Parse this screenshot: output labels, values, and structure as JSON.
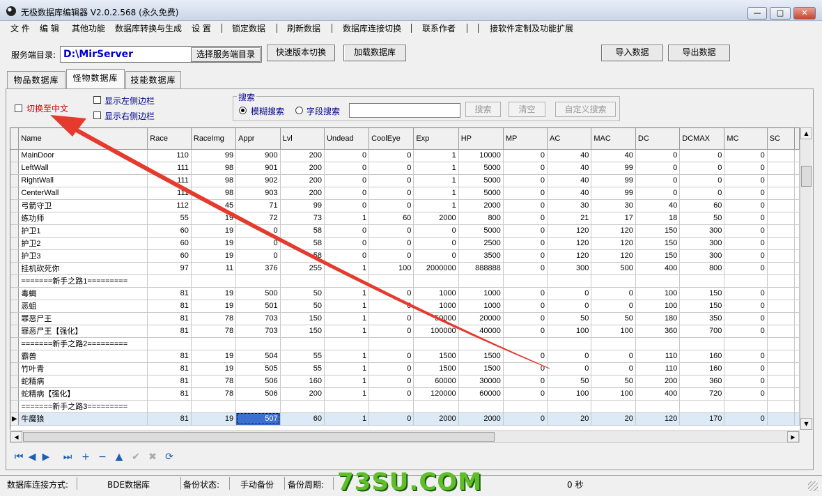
{
  "window": {
    "title": "无极数据库编辑器 V2.0.2.568 (永久免费)",
    "minimize_glyph": "—",
    "maximize_glyph": "□",
    "close_glyph": "✕"
  },
  "menu": [
    "文 件",
    "编 辑",
    "其他功能",
    "数据库转换与生成",
    "设 置",
    "锁定数据",
    "刷新数据",
    "数据库连接切换",
    "联系作者",
    "接软件定制及功能扩展"
  ],
  "toolbar": {
    "server_dir_label": "服务端目录:",
    "server_dir_value": "D:\\MirServer",
    "browse_button": "选择服务端目录",
    "quick_switch_button": "快速版本切换",
    "load_db_button": "加载数据库",
    "import_button": "导入数据",
    "export_button": "导出数据"
  },
  "tabs": [
    "物品数据库",
    "怪物数据库",
    "技能数据库"
  ],
  "active_tab": "怪物数据库",
  "options": {
    "switch_chinese": "切换至中文",
    "show_left_sidebar": "显示左侧边栏",
    "show_right_sidebar": "显示右侧边栏"
  },
  "search": {
    "legend": "搜索",
    "fuzzy_label": "模糊搜索",
    "field_label": "字段搜索",
    "query_value": "",
    "search_button": "搜索",
    "clear_button": "清空",
    "custom_button": "自定义搜索"
  },
  "grid": {
    "columns": [
      "Name",
      "Race",
      "RaceImg",
      "Appr",
      "Lvl",
      "Undead",
      "CoolEye",
      "Exp",
      "HP",
      "MP",
      "AC",
      "MAC",
      "DC",
      "DCMAX",
      "MC",
      "SC"
    ],
    "rows": [
      [
        "MainDoor",
        "110",
        "99",
        "900",
        "200",
        "0",
        "0",
        "1",
        "10000",
        "0",
        "40",
        "40",
        "0",
        "0",
        "0",
        ""
      ],
      [
        "LeftWall",
        "111",
        "98",
        "901",
        "200",
        "0",
        "0",
        "1",
        "5000",
        "0",
        "40",
        "99",
        "0",
        "0",
        "0",
        ""
      ],
      [
        "RightWall",
        "111",
        "98",
        "902",
        "200",
        "0",
        "0",
        "1",
        "5000",
        "0",
        "40",
        "99",
        "0",
        "0",
        "0",
        ""
      ],
      [
        "CenterWall",
        "111",
        "98",
        "903",
        "200",
        "0",
        "0",
        "1",
        "5000",
        "0",
        "40",
        "99",
        "0",
        "0",
        "0",
        ""
      ],
      [
        "弓箭守卫",
        "112",
        "45",
        "71",
        "99",
        "0",
        "0",
        "1",
        "2000",
        "0",
        "30",
        "30",
        "40",
        "60",
        "0",
        ""
      ],
      [
        "练功师",
        "55",
        "19",
        "72",
        "73",
        "1",
        "60",
        "2000",
        "800",
        "0",
        "21",
        "17",
        "18",
        "50",
        "0",
        ""
      ],
      [
        "护卫1",
        "60",
        "19",
        "0",
        "58",
        "0",
        "0",
        "0",
        "5000",
        "0",
        "120",
        "120",
        "150",
        "300",
        "0",
        ""
      ],
      [
        "护卫2",
        "60",
        "19",
        "0",
        "58",
        "0",
        "0",
        "0",
        "2500",
        "0",
        "120",
        "120",
        "150",
        "300",
        "0",
        ""
      ],
      [
        "护卫3",
        "60",
        "19",
        "0",
        "58",
        "0",
        "0",
        "0",
        "3500",
        "0",
        "120",
        "120",
        "150",
        "300",
        "0",
        ""
      ],
      [
        "挂机砍死你",
        "97",
        "11",
        "376",
        "255",
        "1",
        "100",
        "2000000",
        "888888",
        "0",
        "300",
        "500",
        "400",
        "800",
        "0",
        ""
      ],
      [
        "=======新手之路1=========",
        "",
        "",
        "",
        "",
        "",
        "",
        "",
        "",
        "",
        "",
        "",
        "",
        "",
        "",
        ""
      ],
      [
        "毒蝎",
        "81",
        "19",
        "500",
        "50",
        "1",
        "0",
        "1000",
        "1000",
        "0",
        "0",
        "0",
        "100",
        "150",
        "0",
        ""
      ],
      [
        "恶蛆",
        "81",
        "19",
        "501",
        "50",
        "1",
        "0",
        "1000",
        "1000",
        "0",
        "0",
        "0",
        "100",
        "150",
        "0",
        ""
      ],
      [
        "罪恶尸王",
        "81",
        "78",
        "703",
        "150",
        "1",
        "0",
        "50000",
        "20000",
        "0",
        "50",
        "50",
        "180",
        "350",
        "0",
        ""
      ],
      [
        "罪恶尸王【强化】",
        "81",
        "78",
        "703",
        "150",
        "1",
        "0",
        "100000",
        "40000",
        "0",
        "100",
        "100",
        "360",
        "700",
        "0",
        ""
      ],
      [
        "=======新手之路2=========",
        "",
        "",
        "",
        "",
        "",
        "",
        "",
        "",
        "",
        "",
        "",
        "",
        "",
        "",
        ""
      ],
      [
        "霸兽",
        "81",
        "19",
        "504",
        "55",
        "1",
        "0",
        "1500",
        "1500",
        "0",
        "0",
        "0",
        "110",
        "160",
        "0",
        ""
      ],
      [
        "竹叶青",
        "81",
        "19",
        "505",
        "55",
        "1",
        "0",
        "1500",
        "1500",
        "0",
        "0",
        "0",
        "110",
        "160",
        "0",
        ""
      ],
      [
        "蛇精病",
        "81",
        "78",
        "506",
        "160",
        "1",
        "0",
        "60000",
        "30000",
        "0",
        "50",
        "50",
        "200",
        "360",
        "0",
        ""
      ],
      [
        "蛇精病【强化】",
        "81",
        "78",
        "506",
        "200",
        "1",
        "0",
        "120000",
        "60000",
        "0",
        "100",
        "100",
        "400",
        "720",
        "0",
        ""
      ],
      [
        "=======新手之路3=========",
        "",
        "",
        "",
        "",
        "",
        "",
        "",
        "",
        "",
        "",
        "",
        "",
        "",
        "",
        ""
      ],
      [
        "牛魔狼",
        "81",
        "19",
        "507",
        "60",
        "1",
        "0",
        "2000",
        "2000",
        "0",
        "20",
        "20",
        "120",
        "170",
        "0",
        ""
      ]
    ],
    "selected_row_index": 21,
    "current_cell_column": "Appr",
    "row_marker_glyph": "▶"
  },
  "navigator": [
    {
      "icon": "first-record-icon",
      "glyph": "⏮",
      "enabled": true
    },
    {
      "icon": "prior-record-icon",
      "glyph": "◀",
      "enabled": true
    },
    {
      "icon": "next-record-icon",
      "glyph": "▶",
      "enabled": true
    },
    {
      "icon": "last-record-icon",
      "glyph": "⏭",
      "enabled": true
    },
    {
      "icon": "insert-record-icon",
      "glyph": "+",
      "enabled": true
    },
    {
      "icon": "delete-record-icon",
      "glyph": "−",
      "enabled": true
    },
    {
      "icon": "edit-record-icon",
      "glyph": "▲",
      "enabled": true
    },
    {
      "icon": "post-record-icon",
      "glyph": "✔",
      "enabled": false
    },
    {
      "icon": "cancel-record-icon",
      "glyph": "✖",
      "enabled": false
    },
    {
      "icon": "refresh-record-icon",
      "glyph": "⟳",
      "enabled": true
    }
  ],
  "status": {
    "connection_label": "数据库连接方式:",
    "connection_value": "BDE数据库",
    "backup_state_label": "备份状态:",
    "backup_state_value": "手动备份",
    "backup_period_label": "备份周期:",
    "backup_period_value": "0 秒"
  },
  "watermark": "73SU.COM",
  "colors": {
    "accent": "#0000cc",
    "selection": "#3b6fd0",
    "selected_row": "#dce9f7",
    "annotation_arrow": "#e53a2e",
    "option_red_text": "#cc0000"
  }
}
